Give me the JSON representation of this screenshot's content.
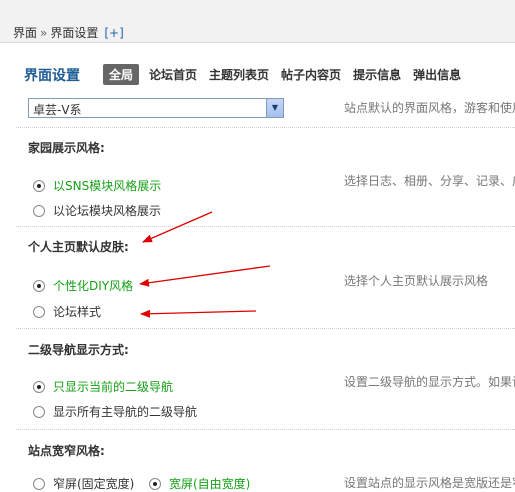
{
  "breadcrumb": {
    "root": "界面",
    "sep": "»",
    "current": "界面设置",
    "add": "[+]"
  },
  "page_title": "界面设置",
  "tabs": [
    "全局",
    "论坛首页",
    "主题列表页",
    "帖子内容页",
    "提示信息",
    "弹出信息"
  ],
  "style_select": {
    "value": "卓芸-V系",
    "description": "站点默认的界面风格，游客和使用"
  },
  "sections": [
    {
      "label": "家园展示风格:",
      "description": "选择日志、相册、分享、记录、广",
      "options": [
        {
          "label": "以SNS模块风格展示",
          "checked": true
        },
        {
          "label": "以论坛模块风格展示",
          "checked": false
        }
      ]
    },
    {
      "label": "个人主页默认皮肤:",
      "description": "选择个人主页默认展示风格",
      "options": [
        {
          "label": "个性化DIY风格",
          "checked": true
        },
        {
          "label": "论坛样式",
          "checked": false
        }
      ]
    },
    {
      "label": "二级导航显示方式:",
      "description": "设置二级导航的显示方式。如果设",
      "options": [
        {
          "label": "只显示当前的二级导航",
          "checked": true
        },
        {
          "label": "显示所有主导航的二级导航",
          "checked": false
        }
      ]
    },
    {
      "label": "站点宽窄风格:",
      "description": "设置站点的显示风格是宽版还是窄",
      "options": [
        {
          "label": "窄屏(固定宽度)",
          "checked": false
        },
        {
          "label": "宽屏(自由宽度)",
          "checked": true
        }
      ]
    }
  ],
  "colors": {
    "title": "#1f5d96",
    "selected_option": "#16a116",
    "arrow": "#e00000",
    "active_tab_bg": "#666666"
  }
}
